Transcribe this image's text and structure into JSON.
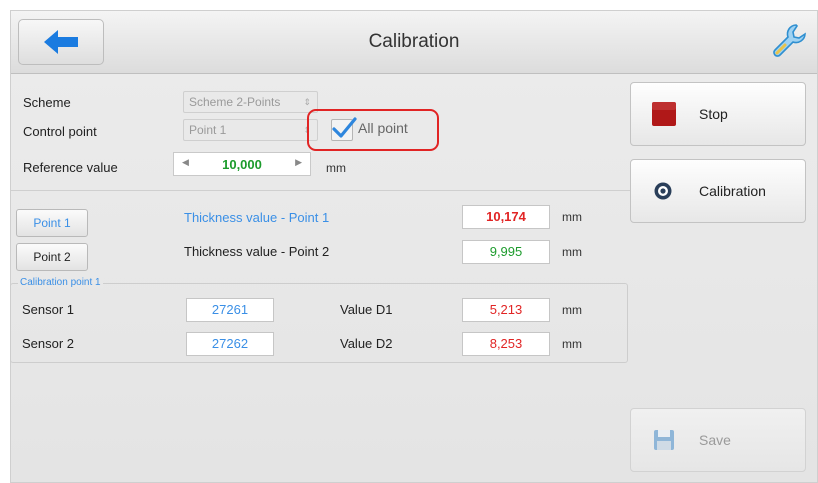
{
  "header": {
    "title": "Calibration"
  },
  "form": {
    "scheme_label": "Scheme",
    "scheme_value": "Scheme 2-Points",
    "control_point_label": "Control point",
    "control_point_value": "Point 1",
    "all_point_label": "All point",
    "all_point_checked": true,
    "reference_label": "Reference value",
    "reference_value": "10,000",
    "reference_unit": "mm"
  },
  "points": [
    {
      "button": "Point 1",
      "label": "Thickness value - Point 1",
      "value": "10,174",
      "unit": "mm"
    },
    {
      "button": "Point 2",
      "label": "Thickness value - Point 2",
      "value": "9,995",
      "unit": "mm"
    }
  ],
  "calibration_group": {
    "title": "Calibration point 1",
    "rows": [
      {
        "sensor_label": "Sensor 1",
        "sensor_value": "27261",
        "value_label": "Value D1",
        "value": "5,213",
        "unit": "mm"
      },
      {
        "sensor_label": "Sensor 2",
        "sensor_value": "27262",
        "value_label": "Value D2",
        "value": "8,253",
        "unit": "mm"
      }
    ]
  },
  "actions": {
    "stop_label": "Stop",
    "calibration_label": "Calibration",
    "save_label": "Save"
  },
  "colors": {
    "accent_blue": "#1a7be0",
    "selected_blue": "#3a8fe6",
    "stop_red": "#b01818",
    "highlight_red": "#e12424",
    "value_green": "#1c9b2c"
  }
}
